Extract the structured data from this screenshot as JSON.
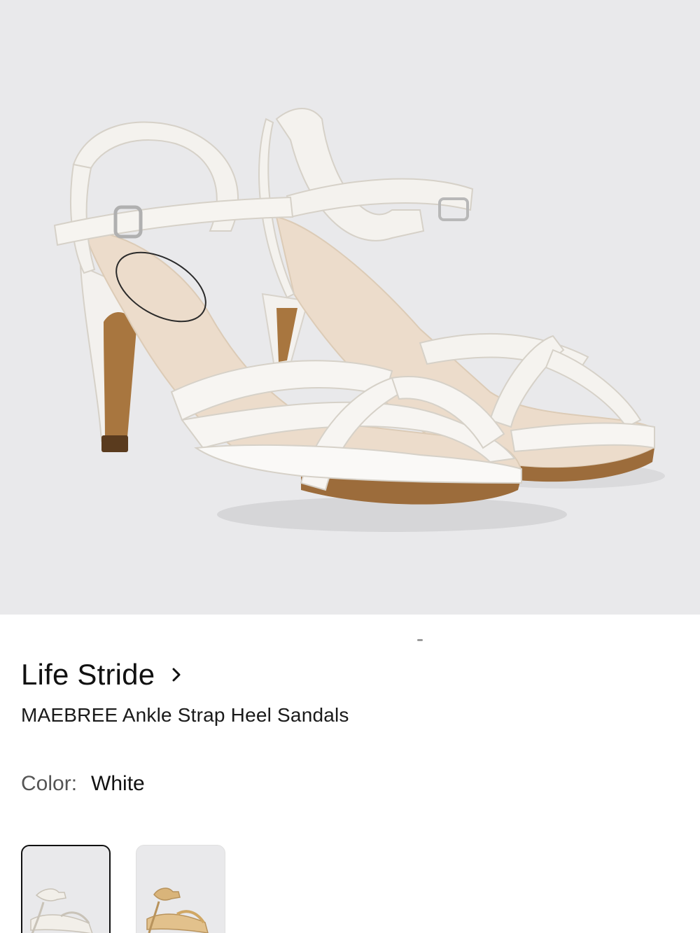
{
  "product": {
    "brand": "Life Stride",
    "name": "MAEBREE Ankle Strap Heel Sandals",
    "image_alt_icon": "sandal-product-image"
  },
  "color": {
    "label": "Color:",
    "value": "White"
  },
  "swatches": [
    {
      "name": "White",
      "selected": true,
      "color": "#f2efe9"
    },
    {
      "name": "Tan",
      "selected": false,
      "color": "#d9b47a"
    }
  ],
  "colors": {
    "hero_background": "#e9e9eb",
    "text": "#111111",
    "label": "#555555"
  }
}
